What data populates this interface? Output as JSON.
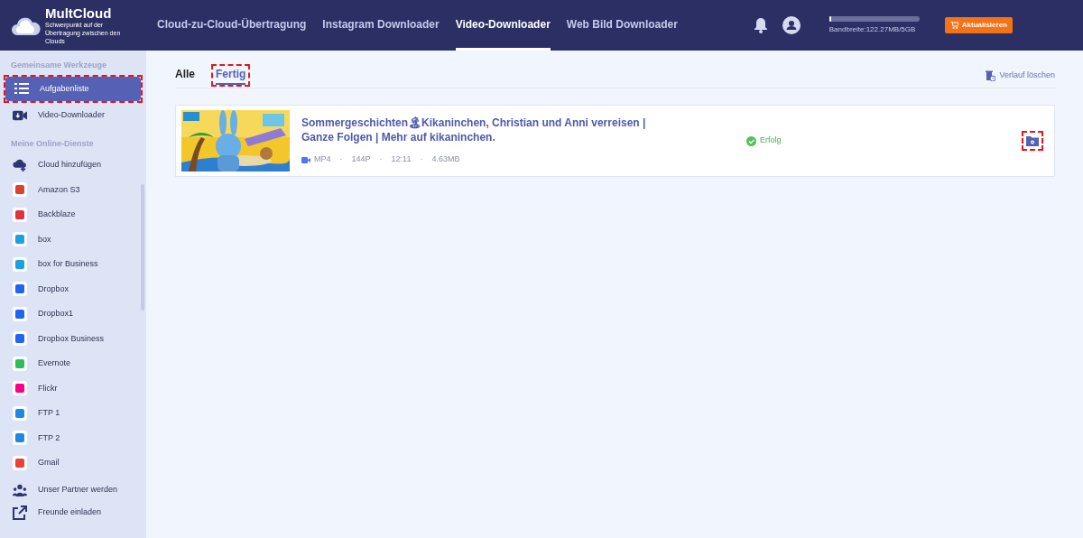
{
  "header": {
    "logo": {
      "name": "MultCloud",
      "tagline": "Schwerpunkt auf der Übertragung zwischen den Clouds"
    },
    "nav": [
      {
        "label": "Cloud-zu-Cloud-Übertragung",
        "selected": false
      },
      {
        "label": "Instagram Downloader",
        "selected": false
      },
      {
        "label": "Video-Downloader",
        "selected": true
      },
      {
        "label": "Web Bild Downloader",
        "selected": false
      }
    ],
    "bandwidth": {
      "level": 0.02,
      "label": "Bandbreite:122.27MB/5GB"
    },
    "upgrade_button": "Aktualisieren"
  },
  "sidebar": {
    "sections": [
      {
        "title": "Gemeinsame Werkzeuge",
        "items": [
          {
            "label": "Aufgabenliste",
            "kind": "list",
            "selected": true,
            "highlighted": true
          },
          {
            "label": "Video-Downloader",
            "kind": "video",
            "selected": false,
            "highlighted": false
          }
        ]
      },
      {
        "title": "Meine Online-Dienste",
        "items": [
          {
            "label": "Cloud hinzufügen",
            "kind": "cloud-add",
            "selected": false,
            "highlighted": false
          },
          {
            "label": "Amazon S3",
            "kind": "service",
            "color": "#d9432f",
            "selected": false,
            "highlighted": false
          },
          {
            "label": "Backblaze",
            "kind": "service",
            "color": "#e0313d",
            "selected": false,
            "highlighted": false
          },
          {
            "label": "box",
            "kind": "service",
            "color": "#1ba1e2",
            "selected": false,
            "highlighted": false
          },
          {
            "label": "box for Business",
            "kind": "service",
            "color": "#1ba1e2",
            "selected": false,
            "highlighted": false
          },
          {
            "label": "Dropbox",
            "kind": "service",
            "color": "#1f64f2",
            "selected": false,
            "highlighted": false
          },
          {
            "label": "Dropbox1",
            "kind": "service",
            "color": "#1f64f2",
            "selected": false,
            "highlighted": false
          },
          {
            "label": "Dropbox Business",
            "kind": "service",
            "color": "#1f64f2",
            "selected": false,
            "highlighted": false
          },
          {
            "label": "Evernote",
            "kind": "service",
            "color": "#2dbe60",
            "selected": false,
            "highlighted": false
          },
          {
            "label": "Flickr",
            "kind": "service",
            "color": "#ff0084",
            "selected": false,
            "highlighted": false
          },
          {
            "label": "FTP 1",
            "kind": "service",
            "color": "#1e88e5",
            "selected": false,
            "highlighted": false
          },
          {
            "label": "FTP 2",
            "kind": "service",
            "color": "#1e88e5",
            "selected": false,
            "highlighted": false
          },
          {
            "label": "Gmail",
            "kind": "service",
            "color": "#ea4335",
            "selected": false,
            "highlighted": false
          }
        ]
      }
    ],
    "footer": [
      {
        "label": "Unser Partner werden",
        "kind": "partner"
      },
      {
        "label": "Freunde einladen",
        "kind": "invite"
      }
    ]
  },
  "main": {
    "tabs": [
      {
        "label": "Alle",
        "selected": false,
        "highlighted": false
      },
      {
        "label": "Fertig",
        "selected": true,
        "highlighted": true
      }
    ],
    "clear_history": "Verlauf löschen",
    "tasks": [
      {
        "title": "Sommergeschichten🏝Kikaninchen, Christian und Anni verreisen | Ganze Folgen | Mehr auf kikaninchen.",
        "format": "MP4",
        "quality": "144P",
        "duration": "12:11",
        "size": "4.63MB",
        "separator": "·",
        "status": "Erfolg",
        "open_highlighted": true
      }
    ]
  }
}
